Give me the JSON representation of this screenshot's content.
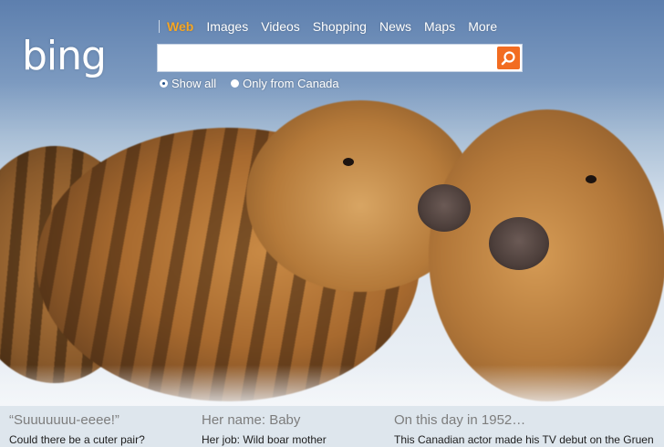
{
  "logo": {
    "text": "bing"
  },
  "nav": {
    "items": [
      {
        "label": "Web",
        "active": true
      },
      {
        "label": "Images"
      },
      {
        "label": "Videos"
      },
      {
        "label": "Shopping"
      },
      {
        "label": "News"
      },
      {
        "label": "Maps"
      },
      {
        "label": "More"
      }
    ],
    "active_color": "#f6a623"
  },
  "search": {
    "value": "",
    "placeholder": "",
    "button_icon": "search-icon",
    "button_color": "#f26c21"
  },
  "options": [
    {
      "label": "Show all",
      "checked": true
    },
    {
      "label": "Only from Canada",
      "checked": false
    }
  ],
  "background": {
    "image": "two wild boar piglets in snow"
  },
  "hotspots": [
    {
      "title": "“Suuuuuuu-eeee!”",
      "text": "Could there be a cuter pair?"
    },
    {
      "title": "Her name: Baby",
      "text": "Her job: Wild boar mother"
    },
    {
      "title": "On this day in 1952…",
      "text": "This Canadian actor made his TV debut on the Gruen"
    }
  ]
}
